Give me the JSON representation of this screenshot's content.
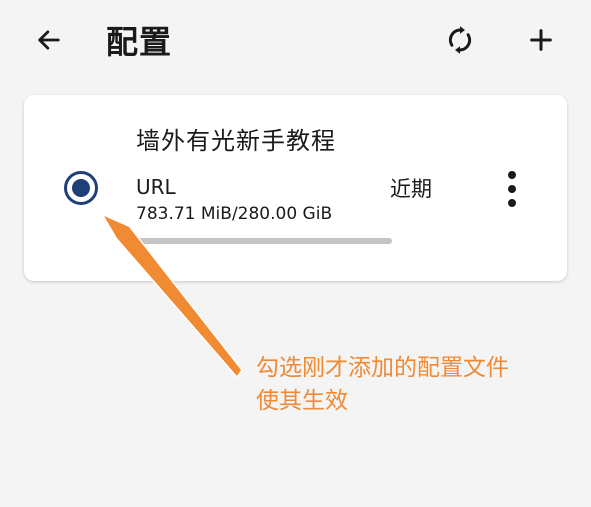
{
  "appbar": {
    "title": "配置",
    "back_icon": "arrow-left-icon",
    "refresh_icon": "refresh-icon",
    "add_icon": "plus-icon"
  },
  "profile": {
    "name": "墙外有光新手教程",
    "type": "URL",
    "usage": "783.71 MiB/280.00 GiB",
    "usage_fraction": 0.0027,
    "update": "近期",
    "selected": true
  },
  "annotation": {
    "line1": "勾选刚才添加的配置文件",
    "line2": "使其生效",
    "color": "#f08a33"
  },
  "colors": {
    "accent": "#1f3f78",
    "track": "#c4c4c4",
    "background": "#f4f4f4"
  }
}
